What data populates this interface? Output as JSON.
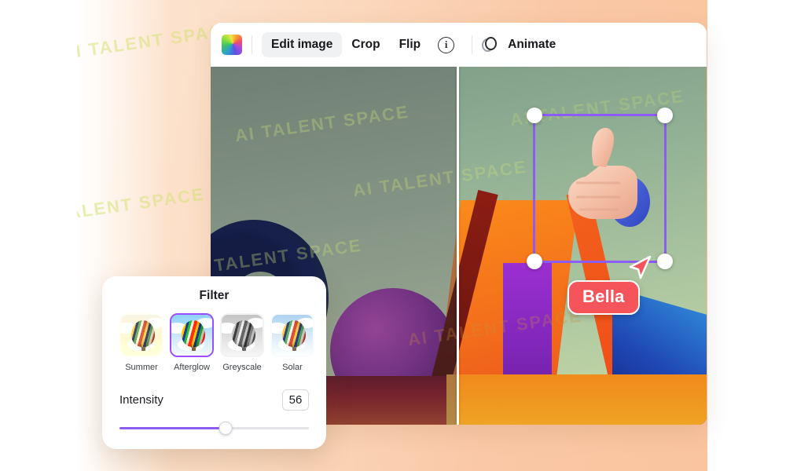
{
  "toolbar": {
    "gradient_icon": "gradient-swatch-icon",
    "items": [
      {
        "label": "Edit image",
        "active": true
      },
      {
        "label": "Crop",
        "active": false
      },
      {
        "label": "Flip",
        "active": false
      }
    ],
    "info_icon_glyph": "i",
    "animate": {
      "icon": "animate-rings-icon",
      "label": "Animate"
    }
  },
  "canvas": {
    "split_divider": "before-after-divider",
    "selection": {
      "handles": [
        "top-left",
        "top-right",
        "bottom-left",
        "bottom-right"
      ],
      "accent_color": "#8b5cf6"
    },
    "cursor": {
      "label": "Bella",
      "badge_color": "#f4545a",
      "badge_text_color": "#ffffff"
    },
    "watermark_text": "AI TALENT SPACE"
  },
  "filter_panel": {
    "title": "Filter",
    "selected": "Afterglow",
    "filters": [
      {
        "name": "Summer",
        "selected": false
      },
      {
        "name": "Afterglow",
        "selected": true
      },
      {
        "name": "Greyscale",
        "selected": false
      },
      {
        "name": "Solar",
        "selected": false
      }
    ],
    "intensity": {
      "label": "Intensity",
      "value": "56",
      "percent": 56
    }
  },
  "theme": {
    "accent": "#8b5cf6",
    "page_background": "#fbd8bd",
    "card_background": "#ffffff"
  }
}
